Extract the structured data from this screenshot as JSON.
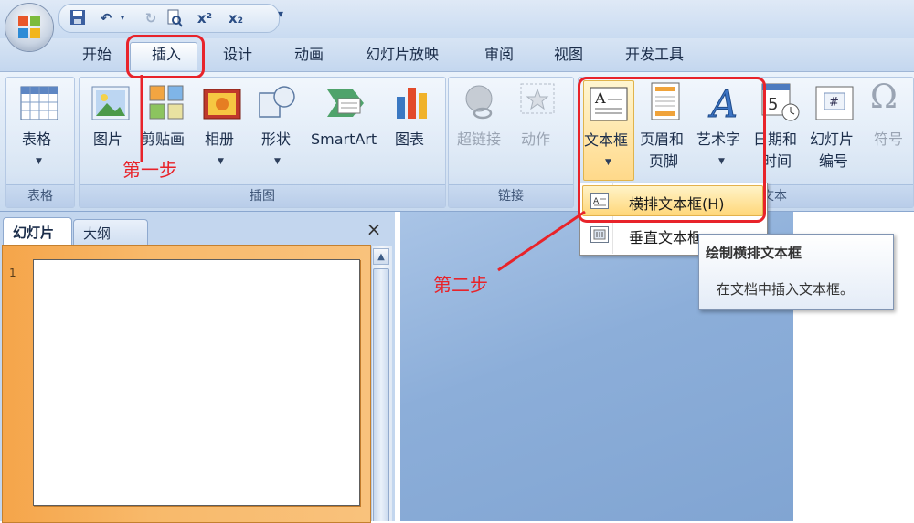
{
  "quick_access": {
    "items": [
      "save-icon",
      "undo-icon",
      "redo-icon",
      "print-preview-icon",
      "superscript-icon",
      "subscript-icon",
      "customize-icon"
    ],
    "superscript_label": "x²",
    "subscript_label": "x₂"
  },
  "tabs": [
    "开始",
    "插入",
    "设计",
    "动画",
    "幻灯片放映",
    "审阅",
    "视图",
    "开发工具"
  ],
  "ribbon": {
    "table_group": {
      "button": "表格",
      "label": "表格"
    },
    "illustrations_group": {
      "buttons": [
        "图片",
        "剪贴画",
        "相册",
        "形状",
        "SmartArt",
        "图表"
      ],
      "label": "插图"
    },
    "links_group": {
      "buttons": [
        "超链接",
        "动作"
      ],
      "label": "链接"
    },
    "text_group": {
      "textbox": "文本框",
      "header_footer": [
        "页眉和",
        "页脚"
      ],
      "wordart": "艺术字",
      "datetime": [
        "日期和",
        "时间"
      ],
      "slide_number": [
        "幻灯片",
        "编号"
      ],
      "symbol": "符号",
      "label": "文本"
    }
  },
  "pane": {
    "tabs": [
      "幻灯片",
      "大纲"
    ],
    "close": "×",
    "slide_number": "1"
  },
  "dropdown": {
    "items": [
      "横排文本框(H)",
      "垂直文本框(V)"
    ]
  },
  "tooltip": {
    "title": "绘制横排文本框",
    "body": "在文档中插入文本框。"
  },
  "annotations": {
    "step1": "第一步",
    "step2": "第二步"
  },
  "colors": {
    "annotation_red": "#e8232a",
    "ribbon_blue": "#d5e3f3",
    "selected_slide_orange": "#f8b96a"
  }
}
